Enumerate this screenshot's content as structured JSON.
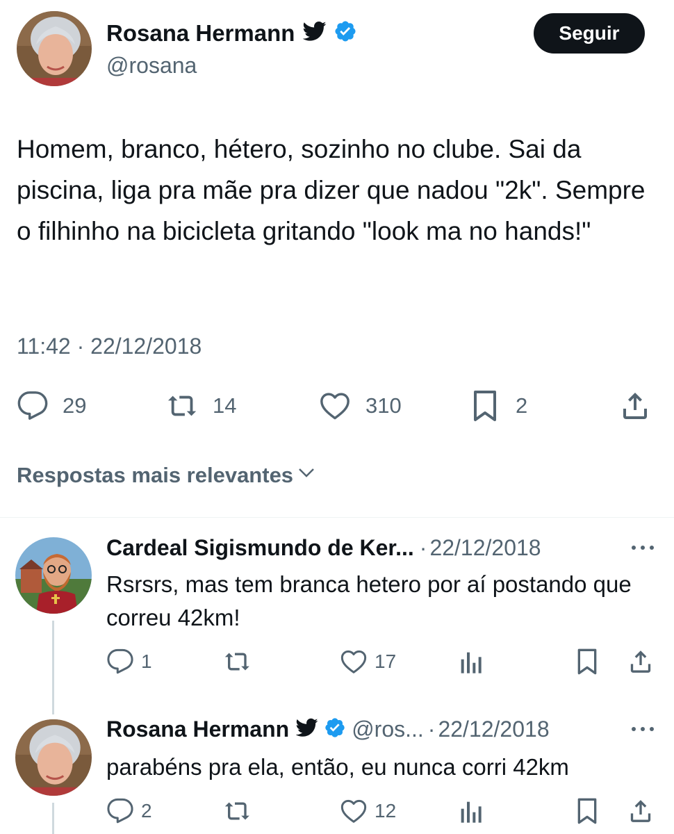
{
  "tweet": {
    "author_name": "Rosana Hermann",
    "author_handle": "@rosana",
    "follow_label": "Seguir",
    "text": "Homem, branco, hétero, sozinho no clube. Sai da piscina, liga pra mãe pra dizer que nadou \"2k\". Sempre o filhinho na bicicleta gritando \"look ma no hands!\"",
    "time": "11:42",
    "separator": "·",
    "date": "22/12/2018",
    "stats": {
      "replies": "29",
      "retweets": "14",
      "likes": "310",
      "bookmarks": "2"
    }
  },
  "replies_sort_label": "Respostas mais relevantes",
  "replies": [
    {
      "author_name": "Cardeal Sigismundo de Ker...",
      "date": "22/12/2018",
      "separator": "·",
      "text": "Rsrsrs, mas tem branca hetero por aí postando que correu 42km!",
      "replies": "1",
      "likes": "17"
    },
    {
      "author_name": "Rosana Hermann",
      "author_handle": "@ros...",
      "date": "22/12/2018",
      "separator": "·",
      "text": "parabéns pra ela, então, eu nunca corri 42km",
      "replies": "2",
      "likes": "12"
    }
  ],
  "colors": {
    "verified": "#1d9bf0",
    "text": "#0f1419",
    "secondary": "#536471",
    "button_bg": "#0f1419"
  },
  "icons": [
    "bird-icon",
    "verified-badge-icon",
    "reply-icon",
    "retweet-icon",
    "like-icon",
    "bookmark-icon",
    "share-icon",
    "views-icon",
    "more-icon",
    "chevron-down-icon"
  ]
}
